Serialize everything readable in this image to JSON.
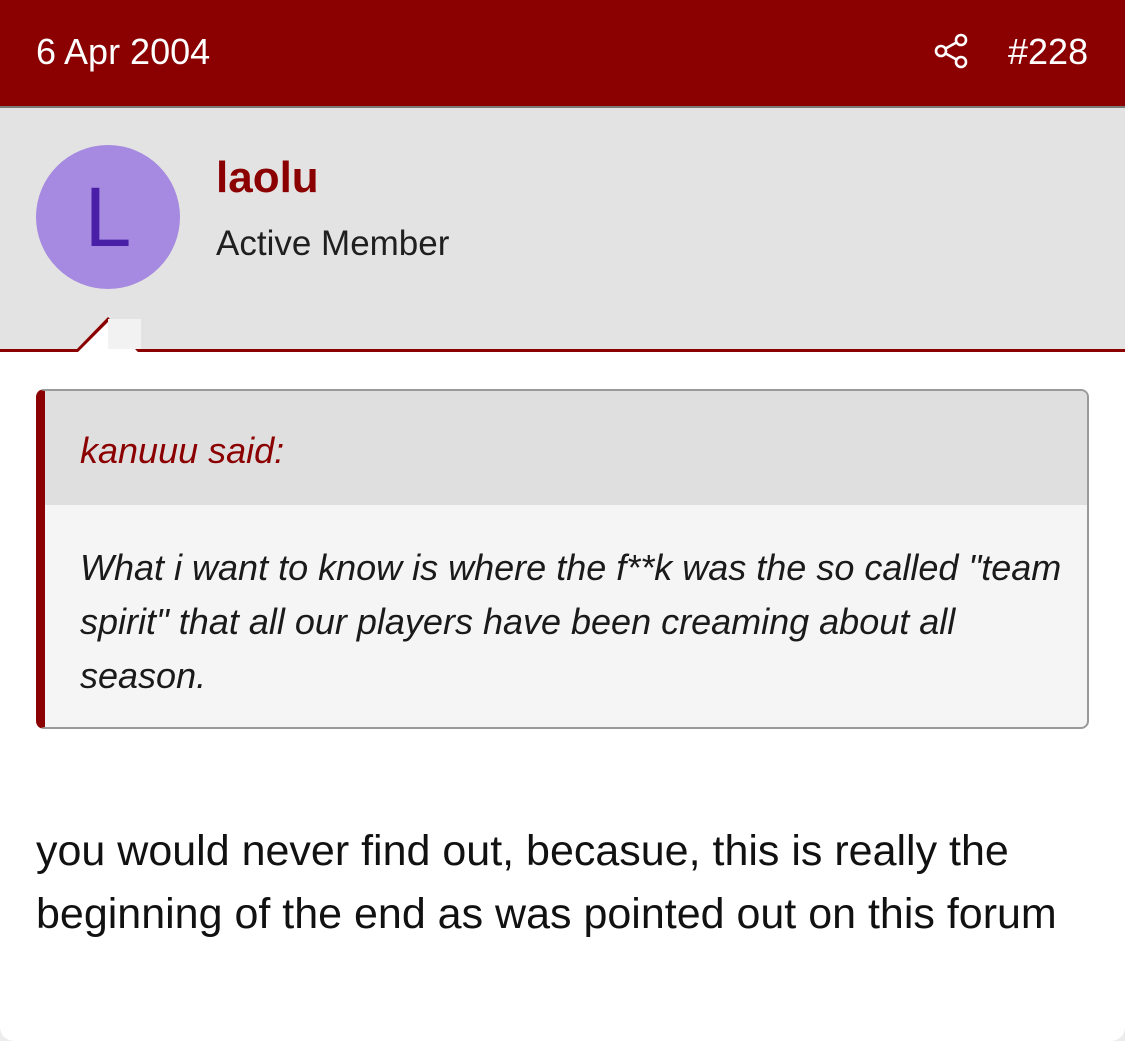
{
  "header": {
    "date": "6 Apr 2004",
    "share_icon": "share-icon",
    "post_number": "#228",
    "color": "#8b0000"
  },
  "author": {
    "avatar_letter": "L",
    "avatar_color": "#a689e0",
    "name": "laolu",
    "title": "Active Member"
  },
  "quote": {
    "author_line": "kanuuu said:",
    "text": "What i want to know is where the f**k was the so called \"team spirit\" that all our players have been creaming about all season."
  },
  "message": {
    "text": "you would never find out, becasue, this is really the beginning of the end as was pointed out on this forum"
  }
}
